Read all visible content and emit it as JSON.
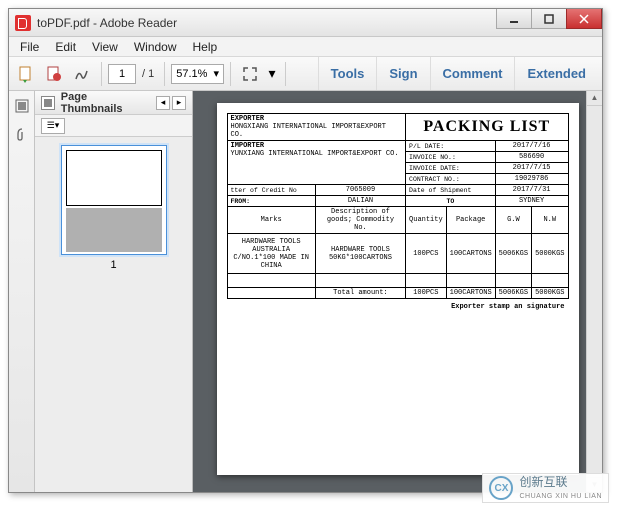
{
  "window": {
    "title": "toPDF.pdf - Adobe Reader"
  },
  "menu": [
    "File",
    "Edit",
    "View",
    "Window",
    "Help"
  ],
  "toolbar": {
    "page_current": "1",
    "page_total": "/ 1",
    "zoom": "57.1%"
  },
  "right_tools": [
    "Tools",
    "Sign",
    "Comment",
    "Extended"
  ],
  "panel": {
    "title": "Page Thumbnails",
    "thumb_number": "1"
  },
  "doc": {
    "exporter_label": "EXPORTER",
    "exporter_name": "HONGXIANG INTERNATIONAL IMPORT&EXPORT CO.",
    "title": "PACKING LIST",
    "importer_label": "IMPORTER",
    "importer_name": "YUNXIANG INTERNATIONAL IMPORT&EXPORT CO.",
    "pl_date_label": "P/L DATE:",
    "pl_date": "2017/7/16",
    "invoice_no_label": "INVOICE NO.:",
    "invoice_no": "586690",
    "invoice_date_label": "INVOICE DATE:",
    "invoice_date": "2017/7/15",
    "contract_no_label": "CONTRACT NO.:",
    "contract_no": "19029786",
    "credit_label": "tter of Credit No",
    "credit_no": "7065009",
    "ship_date_label": "Date of Shipment",
    "ship_date": "2017/7/31",
    "from_label": "FROM:",
    "from": "DALIAN",
    "to_label": "TO",
    "to": "SYDNEY",
    "col_marks": "Marks",
    "col_desc": "Description of goods; Commodity No.",
    "col_qty": "Quantity",
    "col_pkg": "Package",
    "col_gw": "G.W",
    "col_nw": "N.W",
    "row_marks": "HARDWARE TOOLS AUSTRALIA C/NO.1*100 MADE IN CHINA",
    "row_desc": "HARDWARE TOOLS 50KG*100CARTONS",
    "row_qty": "100PCS",
    "row_pkg": "100CARTONS",
    "row_gw": "5006KGS",
    "row_nw": "5000KGS",
    "total_label": "Total amount:",
    "total_qty": "100PCS",
    "total_pkg": "100CARTONS",
    "total_gw": "5006KGS",
    "total_nw": "5000KGS",
    "footer": "Exporter stamp an signature"
  },
  "watermark": {
    "text": "创新互联",
    "sub": "CHUANG XIN HU LIAN"
  }
}
